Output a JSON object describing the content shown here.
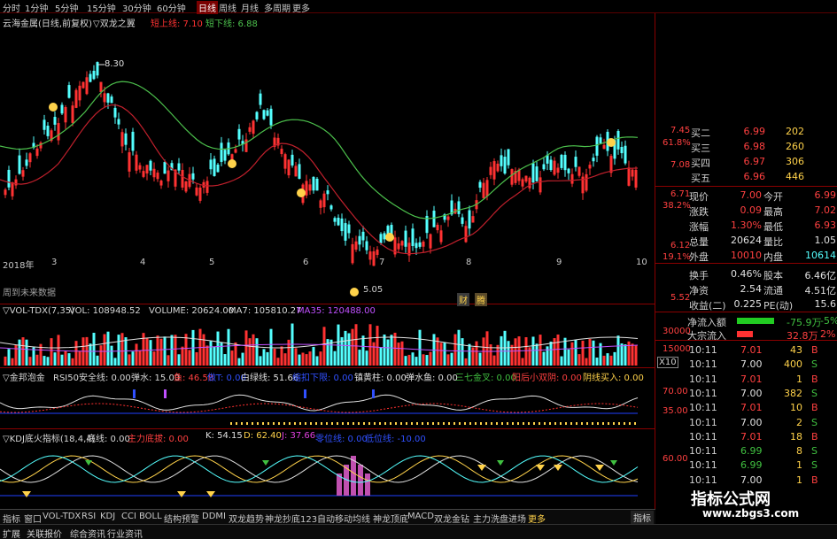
{
  "period_bar": {
    "items": [
      "分时",
      "1分钟",
      "5分钟",
      "15分钟",
      "30分钟",
      "60分钟",
      "日线",
      "周线",
      "月线",
      "多周期",
      "更多"
    ],
    "active_index": 6
  },
  "main_pane": {
    "title": "云海金属(日线,前复权)",
    "indicator_name": "▽双龙之翼",
    "upper_label": "短上线: 7.10",
    "lower_label": "短下线: 6.88",
    "high_marker": "8.30",
    "left_price_marker": "5.05",
    "future_label": "周到未来数据",
    "event_icons": [
      "财",
      "腾"
    ],
    "axis_labels": [
      "7.45",
      "61.8%",
      "7.08",
      "6.71",
      "38.2%",
      "6.12",
      "19.1%",
      "5.52"
    ],
    "colors": {
      "up": "#ff3232",
      "down": "#54ffff",
      "ma_long": "#4cc04c",
      "ma_short": "#c0202c"
    }
  },
  "volume_pane": {
    "label": "▽VOL-TDX(7,35)",
    "vol": "VOL: 108948.52",
    "volume": "VOLUME: 20624.00",
    "ma7": "MA7: 105810.27",
    "ma35": "MA35: 120488.00",
    "axis_labels": [
      "30000",
      "15000",
      "X10"
    ]
  },
  "signal_pane": {
    "label": "▽金邦泡金",
    "items": [
      "RSI50安全线: 0.00",
      "弹水: 15.00",
      "鱼: 46.58",
      "做T: 0.00",
      "白绿线: 51.66",
      "缩扣下限: 0.00",
      "镇黄柱: 0.00",
      "弹水鱼: 0.00",
      "三七金叉: 0.00",
      "阳后小双阴: 0.00",
      "阴线买入: 0.00"
    ],
    "axis_labels": [
      "70.00",
      "35.00"
    ]
  },
  "kdj_pane": {
    "label": "▽KDJ底火指标(18,4,4)",
    "items": [
      "底线: 0.00",
      "主力底拔: 0.00",
      "K: 54.15",
      "D: 62.40",
      "J: 37.66",
      "零位线: 0.00",
      "低位线: -10.00"
    ],
    "axis_labels": [
      "60.00",
      "10"
    ]
  },
  "date_labels": [
    "2018年",
    "3",
    "4",
    "5",
    "6",
    "7",
    "8",
    "9",
    "10"
  ],
  "quote_panel": {
    "sell_rows": [
      {
        "label": "买二",
        "price": "6.99",
        "volume": "202"
      },
      {
        "label": "买三",
        "price": "6.98",
        "volume": "260"
      },
      {
        "label": "买四",
        "price": "6.97",
        "volume": "306"
      },
      {
        "label": "买五",
        "price": "6.96",
        "volume": "446"
      }
    ],
    "stats": [
      {
        "l1": "现价",
        "v1": "7.00",
        "l2": "今开",
        "v2": "6.99"
      },
      {
        "l1": "涨跌",
        "v1": "0.09",
        "l2": "最高",
        "v2": "7.02"
      },
      {
        "l1": "涨幅",
        "v1": "1.30%",
        "l2": "最低",
        "v2": "6.93"
      },
      {
        "l1": "总量",
        "v1": "20624",
        "l2": "量比",
        "v2": "1.05"
      },
      {
        "l1": "外盘",
        "v1": "10010",
        "l2": "内盘",
        "v2": "10614"
      },
      {
        "l1": "换手",
        "v1": "0.46%",
        "l2": "股本",
        "v2": "6.46亿"
      },
      {
        "l1": "净资",
        "v1": "2.54",
        "l2": "流通",
        "v2": "4.51亿"
      },
      {
        "l1": "收益(二)",
        "v1": "0.225",
        "l2": "PE(动)",
        "v2": "15.6"
      }
    ],
    "flow": [
      {
        "label": "净流入额",
        "value": "-75.9万",
        "pct": "-5%",
        "bar_fraction": 0.7,
        "color": "#22cc22"
      },
      {
        "label": "大宗流入",
        "value": "32.8万",
        "pct": "2%",
        "bar_fraction": 0.3,
        "color": "#ff3232"
      }
    ],
    "ticks": [
      {
        "time": "10:11",
        "price": "7.01",
        "vol": "43",
        "side": "B"
      },
      {
        "time": "10:11",
        "price": "7.00",
        "vol": "400",
        "side": "S"
      },
      {
        "time": "10:11",
        "price": "7.01",
        "vol": "1",
        "side": "B"
      },
      {
        "time": "10:11",
        "price": "7.00",
        "vol": "382",
        "side": "S"
      },
      {
        "time": "10:11",
        "price": "7.01",
        "vol": "10",
        "side": "B"
      },
      {
        "time": "10:11",
        "price": "7.00",
        "vol": "2",
        "side": "S"
      },
      {
        "time": "10:11",
        "price": "7.01",
        "vol": "18",
        "side": "B"
      },
      {
        "time": "10:11",
        "price": "6.99",
        "vol": "8",
        "side": "S"
      },
      {
        "time": "10:11",
        "price": "6.99",
        "vol": "1",
        "side": "S"
      },
      {
        "time": "10:11",
        "price": "7.00",
        "vol": "1",
        "side": "B"
      },
      {
        "time": "10:11",
        "price": "7.00",
        "vol": "45",
        "side": "B"
      },
      {
        "time": "10:11",
        "price": "7.00",
        "vol": "1",
        "side": "B"
      }
    ]
  },
  "tabs": [
    "指标",
    "窗口",
    "VOL-TDX",
    "RSI",
    "KDJ",
    "CCI",
    "BOLL",
    "结构预警",
    "DDMI",
    "双龙趋势",
    "神龙抄底123",
    "自动移动均线",
    "神龙顶底",
    "MACD",
    "双龙金钻",
    "主力洗盘进场",
    "更多"
  ],
  "bottom_tabs": [
    "扩展",
    "关联报价",
    "综合资讯",
    "行业资讯"
  ],
  "side_tab": "指标",
  "watermark": {
    "title": "指标公式网",
    "url": "www.zbgs3.com"
  }
}
